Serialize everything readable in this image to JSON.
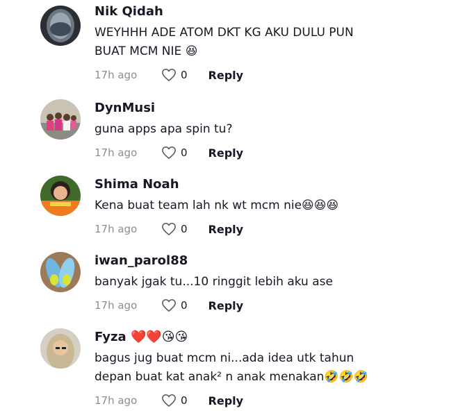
{
  "comments": [
    {
      "username": "Nik Qidah",
      "username_emoji": "",
      "text": "WEYHHH ADE ATOM DKT KG AKU DULU PUN\nBUAT MCM NIE 😆",
      "time": "17h ago",
      "likes": "0",
      "reply": "Reply",
      "avatar": "window-photo"
    },
    {
      "username": "DynMusi",
      "username_emoji": "",
      "text": "guna apps apa spin tu?",
      "time": "17h ago",
      "likes": "0",
      "reply": "Reply",
      "avatar": "group-photo"
    },
    {
      "username": "Shima Noah",
      "username_emoji": "",
      "text": "Kena buat team lah nk wt mcm nie😆😆😆",
      "time": "17h ago",
      "likes": "0",
      "reply": "Reply",
      "avatar": "woman-photo"
    },
    {
      "username": "iwan_parol88",
      "username_emoji": "",
      "text": "banyak jgak tu...10 ringgit lebih aku ase",
      "time": "17h ago",
      "likes": "0",
      "reply": "Reply",
      "avatar": "shoes-photo"
    },
    {
      "username": "Fyza",
      "username_emoji": " ❤️❤️😘😘",
      "text": "bagus jug buat mcm ni...ada idea utk tahun\ndepan buat kat anak² n anak menakan🤣🤣🤣",
      "time": "17h ago",
      "likes": "0",
      "reply": "Reply",
      "avatar": "hijab-photo"
    }
  ]
}
